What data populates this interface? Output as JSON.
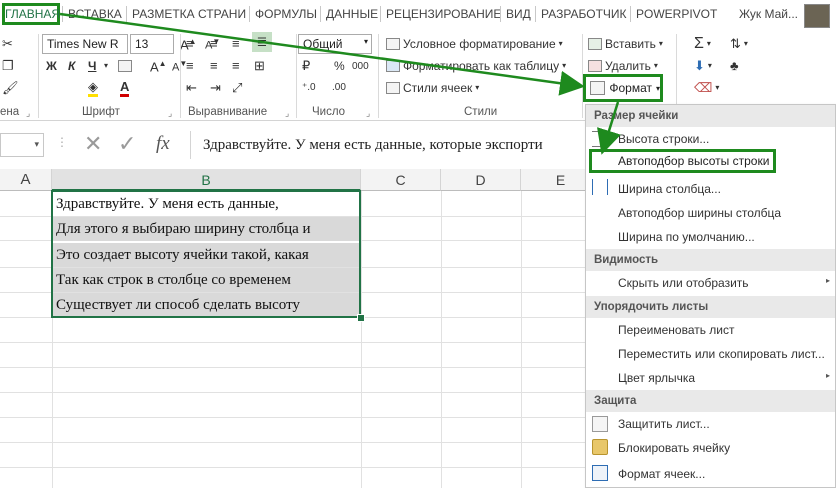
{
  "tabs": {
    "home": "ГЛАВНАЯ",
    "insert": "ВСТАВКА",
    "layout": "РАЗМЕТКА СТРАНИ",
    "formulas": "ФОРМУЛЫ",
    "data": "ДАННЫЕ",
    "review": "РЕЦЕНЗИРОВАНИЕ",
    "view": "ВИД",
    "developer": "РАЗРАБОТЧИК",
    "powerpivot": "POWERPIVOT",
    "user": "Жук Май..."
  },
  "ribbon": {
    "font_name": "Times New R",
    "font_size": "13",
    "number_format": "Общий",
    "cond_format": "Условное форматирование",
    "format_table": "Форматировать как таблицу",
    "cell_styles": "Стили ячеек",
    "insert": "Вставить",
    "delete": "Удалить",
    "format": "Формат",
    "bold": "Ж",
    "italic": "К",
    "underline": "Ч",
    "percent": "%",
    "thousands": "000",
    "font_color_letter": "А",
    "groups": {
      "clipboard_tail": "ена",
      "font": "Шрифт",
      "alignment": "Выравнивание",
      "number": "Число",
      "styles": "Стили"
    }
  },
  "formula_bar": {
    "content": "Здравствуйте. У меня есть данные, которые экспорти",
    "fx": "fx"
  },
  "columns": [
    "A",
    "B",
    "C",
    "D",
    "E"
  ],
  "cells": [
    "Здравствуйте. У меня есть данные,",
    "Для этого я выбираю ширину столбца и",
    "Это создает высоту ячейки такой, какая",
    "Так как строк в столбце со временем",
    "Существует ли способ сделать высоту"
  ],
  "menu": {
    "cell_size": "Размер ячейки",
    "row_height": "Высота строки...",
    "autofit_row": "Автоподбор высоты строки",
    "col_width": "Ширина столбца...",
    "autofit_col": "Автоподбор ширины столбца",
    "default_width": "Ширина по умолчанию...",
    "visibility": "Видимость",
    "hide_show": "Скрыть или отобразить",
    "organize": "Упорядочить листы",
    "rename": "Переименовать лист",
    "move_copy": "Переместить или скопировать лист...",
    "tab_color": "Цвет ярлычка",
    "protection": "Защита",
    "protect_sheet": "Защитить лист...",
    "lock_cell": "Блокировать ячейку",
    "format_cells": "Формат ячеек..."
  },
  "colors": {
    "highlight": "#1e8a1e",
    "excel_green": "#217346"
  }
}
